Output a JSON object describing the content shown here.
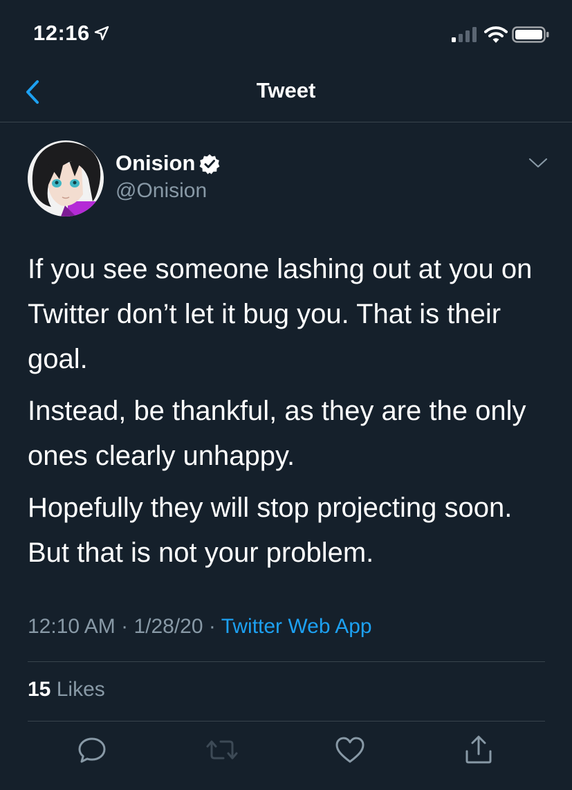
{
  "status_bar": {
    "time": "12:16",
    "location_icon": "location-arrow-icon",
    "signal_icon": "cellular-signal-icon",
    "wifi_icon": "wifi-icon",
    "battery_icon": "battery-icon"
  },
  "nav": {
    "title": "Tweet",
    "back_icon": "chevron-left-icon"
  },
  "tweet": {
    "author_name": "Onision",
    "handle": "@Onision",
    "verified": true,
    "paragraphs": [
      "If you see someone lashing out at you on Twitter don’t let it bug you. That is their goal.",
      "Instead, be thankful, as they are the only ones clearly unhappy.",
      "Hopefully they will stop projecting soon. But that is not your problem."
    ],
    "time": "12:10 AM",
    "separator": "·",
    "date": "1/28/20",
    "source": "Twitter Web App",
    "like_count": "15",
    "like_label": "Likes"
  },
  "actions": [
    "reply-icon",
    "retweet-icon",
    "like-icon",
    "share-icon"
  ],
  "colors": {
    "background": "#15202b",
    "text": "#ffffff",
    "secondary_text": "#8899a6",
    "accent": "#1da1f2",
    "divider": "#38444d"
  }
}
